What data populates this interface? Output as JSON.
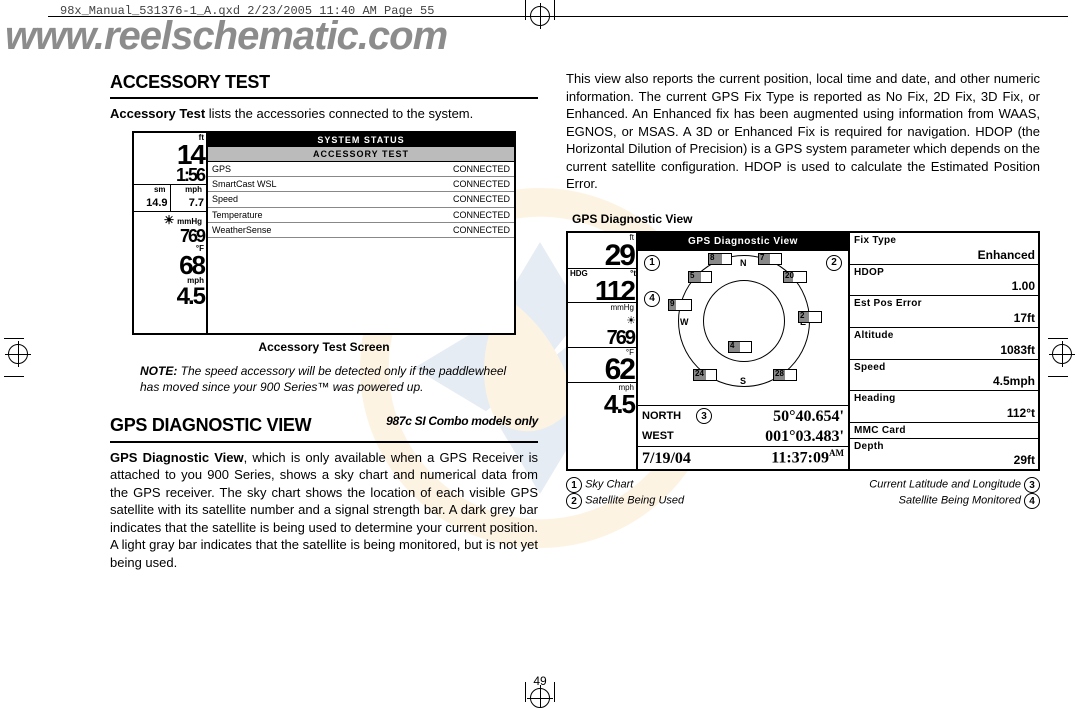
{
  "slug": "98x_Manual_531376-1_A.qxd  2/23/2005  11:40 AM  Page 55",
  "watermark": "www.reelschematic.com",
  "page_number": "49",
  "left": {
    "h1": "ACCESSORY TEST",
    "lead": "Accessory Test lists the accessories connected to the system.",
    "caption": "Accessory Test Screen",
    "note_label": "NOTE:",
    "note": " The speed accessory will be detected only if the paddlewheel has moved since your 900 Series™ was powered up.",
    "h2": "GPS DIAGNOSTIC VIEW",
    "h2_sub": "987c SI Combo models only",
    "para": "GPS Diagnostic View, which is only available when a GPS Receiver is attached to you 900 Series, shows a sky chart and numerical data from the GPS receiver. The sky chart shows the location of each visible GPS satellite with its satellite number and a signal strength bar. A dark grey bar indicates that the satellite is being used to determine your current position. A light gray bar indicates that the satellite is being monitored, but is not yet being used."
  },
  "right": {
    "para": "This view also reports the current position, local time and date, and other numeric information. The current GPS Fix Type is reported as No Fix, 2D Fix, 3D Fix, or Enhanced. An Enhanced fix has been augmented using information from WAAS, EGNOS, or MSAS. A 3D or Enhanced Fix is required for navigation. HDOP (the Horizontal Dilution of Precision) is a GPS system parameter which depends on the current satellite configuration. HDOP is used to calculate the Estimated Position Error.",
    "caption": "GPS Diagnostic View",
    "legend": {
      "l1": "Sky Chart",
      "l2": "Satellite Being Used",
      "r1": "Current Latitude and Longitude",
      "r2": "Satellite Being Monitored"
    }
  },
  "acc": {
    "title": "SYSTEM STATUS",
    "subtitle": "ACCESSORY TEST",
    "rows": [
      {
        "name": "GPS",
        "status": "CONNECTED"
      },
      {
        "name": "SmartCast WSL",
        "status": "CONNECTED"
      },
      {
        "name": "Speed",
        "status": "CONNECTED"
      },
      {
        "name": "Temperature",
        "status": "CONNECTED"
      },
      {
        "name": "WeatherSense",
        "status": "CONNECTED"
      }
    ],
    "depth_unit": "ft",
    "depth": "14",
    "time": "1:56",
    "sm": "14.9",
    "sm_u": "sm",
    "mph": "7.7",
    "mph_u": "mph",
    "mmhg": "769",
    "mmhg_u": "mmHg",
    "temp": "68",
    "temp_u": "°F",
    "speed": "4.5",
    "speed_u": "mph"
  },
  "gps": {
    "title": "GPS Diagnostic View",
    "depth": "29",
    "depth_u": "ft",
    "hdg_lbl": "HDG",
    "hdg": "112",
    "hdg_u": "°t",
    "mmhg": "769",
    "mmhg_u": "mmHg",
    "temp": "62",
    "temp_u": "°F",
    "spd": "4.5",
    "spd_u": "mph",
    "north": "NORTH",
    "west": "WEST",
    "lat": "50°40.654'",
    "lon": "001°03.483'",
    "date": "7/19/04",
    "time": "11:37:09",
    "ampm": "AM",
    "stats": [
      {
        "lbl": "Fix Type",
        "val": "Enhanced"
      },
      {
        "lbl": "HDOP",
        "val": "1.00"
      },
      {
        "lbl": "Est Pos Error",
        "val": "17ft"
      },
      {
        "lbl": "Altitude",
        "val": "1083ft"
      },
      {
        "lbl": "Speed",
        "val": "4.5mph"
      },
      {
        "lbl": "Heading",
        "val": "112°t"
      },
      {
        "lbl": "MMC Card",
        "val": ""
      },
      {
        "lbl": "Depth",
        "val": "29ft"
      }
    ],
    "sats": [
      "8",
      "7",
      "5",
      "20",
      "9",
      "2",
      "4",
      "24",
      "28"
    ]
  }
}
